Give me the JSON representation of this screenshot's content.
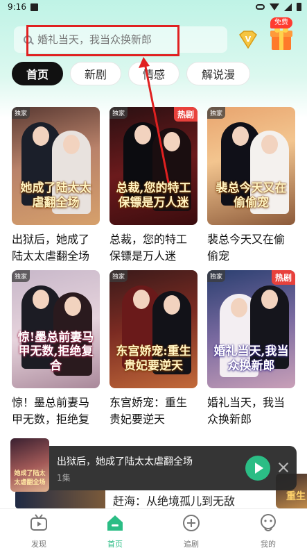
{
  "status_bar": {
    "time": "9:16"
  },
  "search": {
    "placeholder": "婚礼当天，我当众换新郎"
  },
  "top_right": {
    "free_label": "免费"
  },
  "tabs": [
    {
      "label": "首页",
      "active": true
    },
    {
      "label": "新剧",
      "active": false
    },
    {
      "label": "情感",
      "active": false
    },
    {
      "label": "解说漫",
      "active": false
    }
  ],
  "dramas": [
    {
      "title": "出狱后，她成了陆太太虐翻全场",
      "poster_text": "她成了陆太太虐翻全场",
      "exclusive": "独家",
      "hot": ""
    },
    {
      "title": "总裁，您的特工保镖是万人迷",
      "poster_text": "总裁,您的特工保镖是万人迷",
      "exclusive": "独家",
      "hot": "热剧"
    },
    {
      "title": "裴总今天又在偷偷宠",
      "poster_text": "裴总今天又在偷偷宠",
      "exclusive": "独家",
      "hot": ""
    },
    {
      "title": "惊！墨总前妻马甲无数，拒绝复合",
      "poster_text": "惊!墨总前妻马甲无数,拒绝复合",
      "exclusive": "独家",
      "hot": ""
    },
    {
      "title": "东宫娇宠：重生贵妃要逆天",
      "poster_text": "东宫娇宠:重生贵妃要逆天",
      "exclusive": "独家",
      "hot": ""
    },
    {
      "title": "婚礼当天，我当众换新郎",
      "poster_text": "婚礼当天,我当众换新郎",
      "exclusive": "独家",
      "hot": "热剧"
    }
  ],
  "player": {
    "title": "出狱后，她成了陆太太虐翻全场",
    "episode": "1集",
    "thumb_text": "她成了陆太太虐翻全场"
  },
  "peek": {
    "title": "赶海：从绝境孤儿到无敌",
    "right_text": "重生"
  },
  "bottom_nav": [
    {
      "label": "发现",
      "icon": "tv-icon",
      "active": false
    },
    {
      "label": "首页",
      "icon": "home-icon",
      "active": true
    },
    {
      "label": "追剧",
      "icon": "plus-circle-icon",
      "active": false
    },
    {
      "label": "我的",
      "icon": "profile-icon",
      "active": false
    }
  ],
  "colors": {
    "accent": "#2bbd85",
    "hot": "#e8413c",
    "highlight": "#e02020"
  }
}
